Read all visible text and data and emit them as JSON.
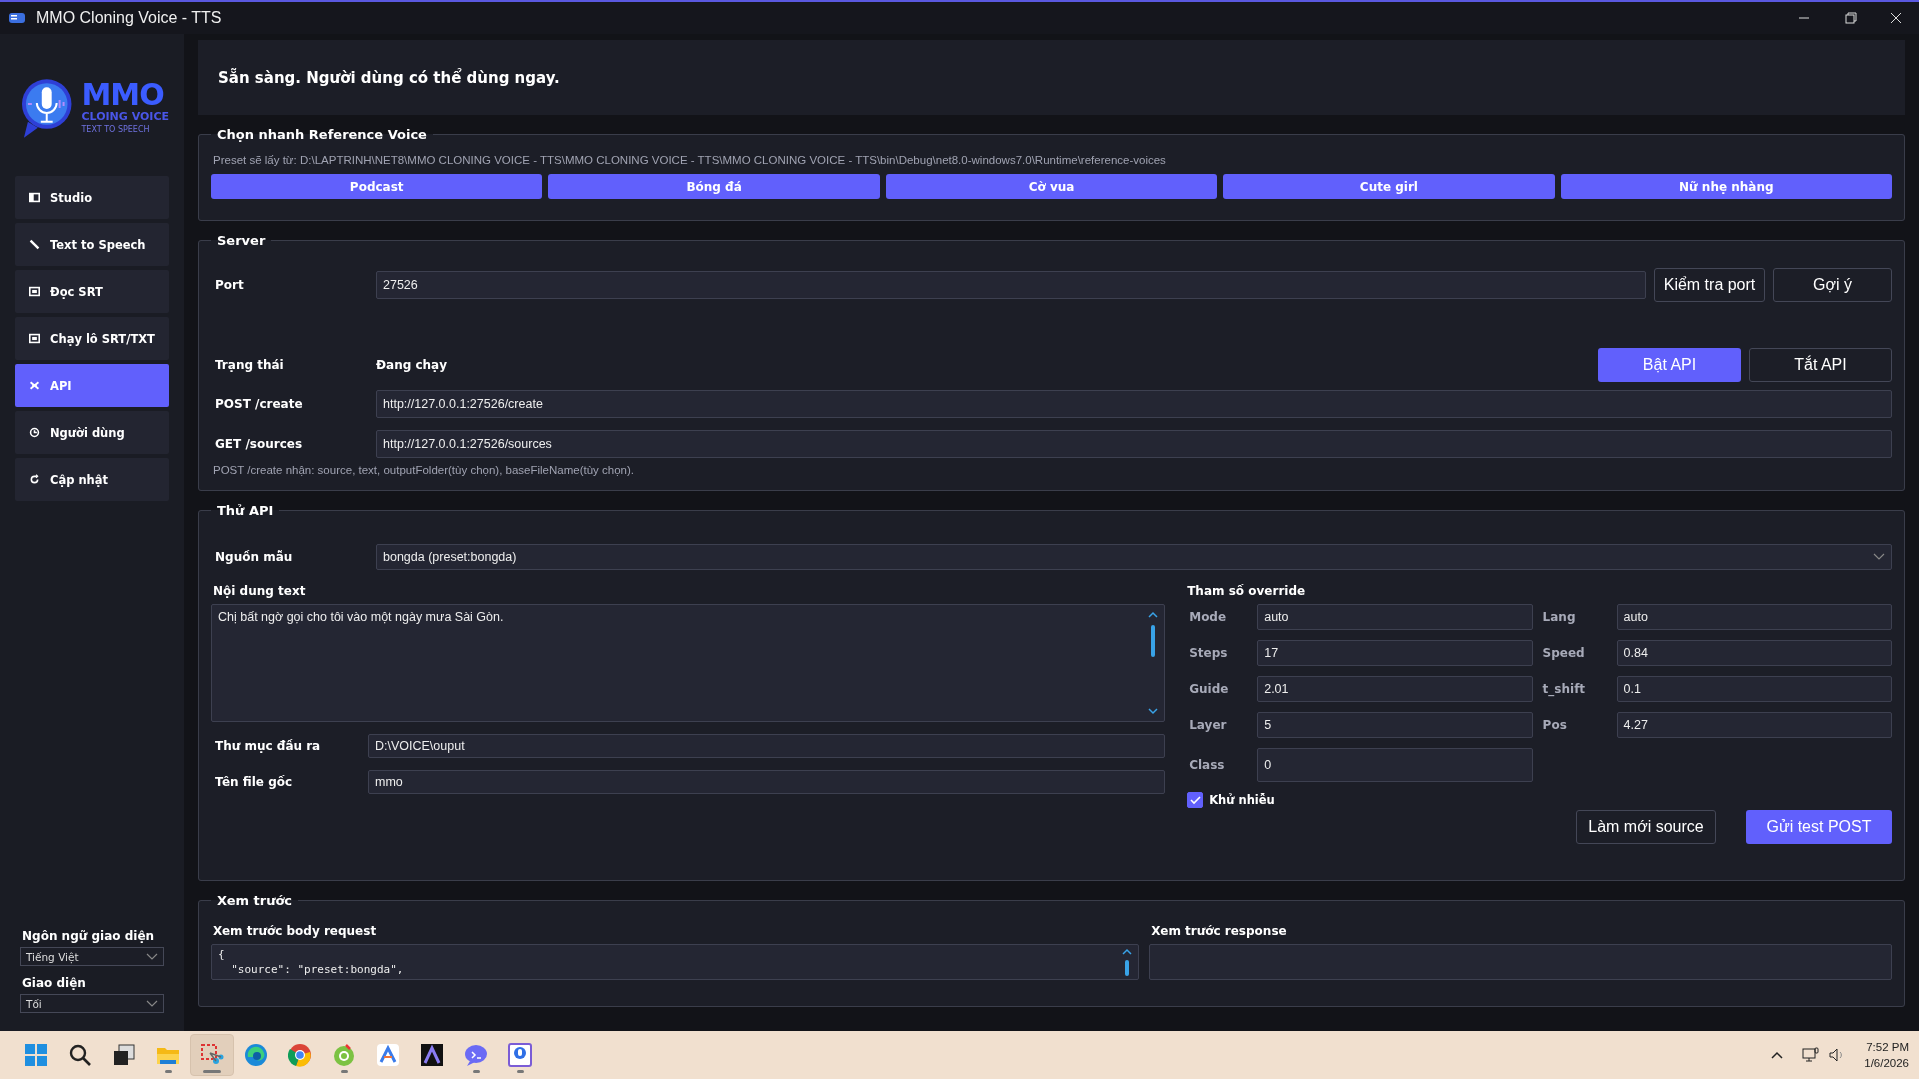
{
  "window": {
    "title": "MMO Cloning Voice - TTS"
  },
  "sidebar": {
    "logo": {
      "title": "MMO",
      "subtitle": "CLOING VOICE",
      "tagline": "TEXT TO SPEECH"
    },
    "items": [
      {
        "label": "Studio",
        "selected": false
      },
      {
        "label": "Text to Speech",
        "selected": false
      },
      {
        "label": "Đọc SRT",
        "selected": false
      },
      {
        "label": "Chạy lô SRT/TXT",
        "selected": false
      },
      {
        "label": "API",
        "selected": true
      },
      {
        "label": "Người dùng",
        "selected": false
      },
      {
        "label": "Cập nhật",
        "selected": false
      }
    ],
    "settings": [
      {
        "label": "Ngôn ngữ giao diện",
        "value": "Tiếng Việt"
      },
      {
        "label": "Giao diện",
        "value": "Tối"
      }
    ]
  },
  "status": "Sẵn sàng. Người dùng có thể dùng ngay.",
  "reference": {
    "title": "Chọn nhanh Reference Voice",
    "preset_path": "Preset sẽ lấy từ: D:\\LAPTRINH\\NET8\\MMO CLONING VOICE - TTS\\MMO CLONING VOICE - TTS\\MMO CLONING VOICE - TTS\\bin\\Debug\\net8.0-windows7.0\\Runtime\\reference-voices",
    "buttons": [
      "Podcast",
      "Bóng đá",
      "Cờ vua",
      "Cute girl",
      "Nữ nhẹ nhàng"
    ]
  },
  "server": {
    "title": "Server",
    "port": {
      "label": "Port",
      "value": "27526"
    },
    "port_buttons": [
      "Kiểm tra port",
      "Gợi ý"
    ],
    "status": {
      "label": "Trạng thái",
      "value": "Đang chạy"
    },
    "api_buttons": [
      {
        "label": "Bật API",
        "kind": "primary"
      },
      {
        "label": "Tắt API",
        "kind": "secondary"
      }
    ],
    "endpoints": [
      {
        "label": "POST /create",
        "value": "http://127.0.0.1:27526/create"
      },
      {
        "label": "GET /sources",
        "value": "http://127.0.0.1:27526/sources"
      }
    ],
    "note": "POST /create nhận: source, text, outputFolder(tùy chọn), baseFileName(tùy chọn)."
  },
  "test": {
    "title": "Thử API",
    "source": {
      "label": "Nguồn mẫu",
      "value": "bongda (preset:bongda)"
    },
    "text": {
      "label": "Nội dung text",
      "value": "Chị bất ngờ gọi cho tôi vào một ngày mưa Sài Gòn."
    },
    "paths": [
      {
        "label": "Thư mục đầu ra",
        "value": "D:\\VOICE\\ouput"
      },
      {
        "label": "Tên file gốc",
        "value": "mmo"
      }
    ],
    "overrides": {
      "title": "Tham số override",
      "fields": [
        {
          "label": "Mode",
          "value": "auto"
        },
        {
          "label": "Lang",
          "value": "auto"
        },
        {
          "label": "Steps",
          "value": "17"
        },
        {
          "label": "Speed",
          "value": "0.84"
        },
        {
          "label": "Guide",
          "value": "2.01"
        },
        {
          "label": "t_shift",
          "value": "0.1"
        },
        {
          "label": "Layer",
          "value": "5"
        },
        {
          "label": "Pos",
          "value": "4.27"
        },
        {
          "label": "Class",
          "value": "0"
        }
      ]
    },
    "denoise": {
      "label": "Khử nhiễu",
      "checked": true
    },
    "buttons": [
      {
        "label": "Làm mới source",
        "kind": "secondary"
      },
      {
        "label": "Gửi test POST",
        "kind": "primary"
      }
    ]
  },
  "preview": {
    "title": "Xem trước",
    "request": {
      "label": "Xem trước body request",
      "lines": [
        "{",
        "  \"source\": \"preset:bongda\","
      ]
    },
    "response": {
      "label": "Xem trước response"
    }
  },
  "taskbar": {
    "apps": [
      {
        "running": false,
        "active": false
      },
      {
        "running": false,
        "active": false
      },
      {
        "running": false,
        "active": false
      },
      {
        "running": true,
        "active": false
      },
      {
        "running": true,
        "active": true
      },
      {
        "running": false,
        "active": false
      },
      {
        "running": false,
        "active": false
      },
      {
        "running": true,
        "active": false
      },
      {
        "running": false,
        "active": false
      },
      {
        "running": false,
        "active": false
      },
      {
        "running": true,
        "active": false
      },
      {
        "running": true,
        "active": false
      }
    ],
    "time": "7:52 PM",
    "date": "1/6/2026"
  }
}
